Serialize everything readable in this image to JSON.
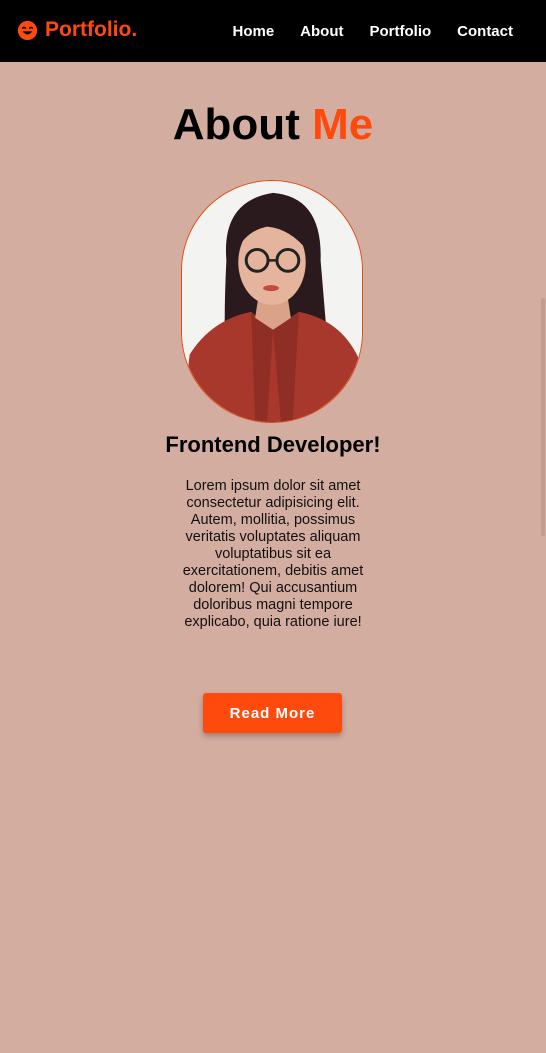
{
  "header": {
    "logo_text": "Portfolio.",
    "logo_icon": "smile-icon",
    "nav": [
      {
        "label": "Home"
      },
      {
        "label": "About"
      },
      {
        "label": "Portfolio"
      },
      {
        "label": "Contact"
      }
    ]
  },
  "about": {
    "heading_main": "About",
    "heading_accent": "Me",
    "role": "Frontend Developer!",
    "description": "Lorem ipsum dolor sit amet consectetur adipisicing elit. Autem, mollitia, possimus veritatis voluptates aliquam voluptatibus sit ea exercitationem, debitis amet dolorem! Qui accusantium doloribus magni tempore explicabo, quia ratione iure!",
    "button_label": "Read More"
  },
  "colors": {
    "accent": "#ff4a0e",
    "header_bg": "#000000",
    "page_bg": "#d4ada1"
  }
}
